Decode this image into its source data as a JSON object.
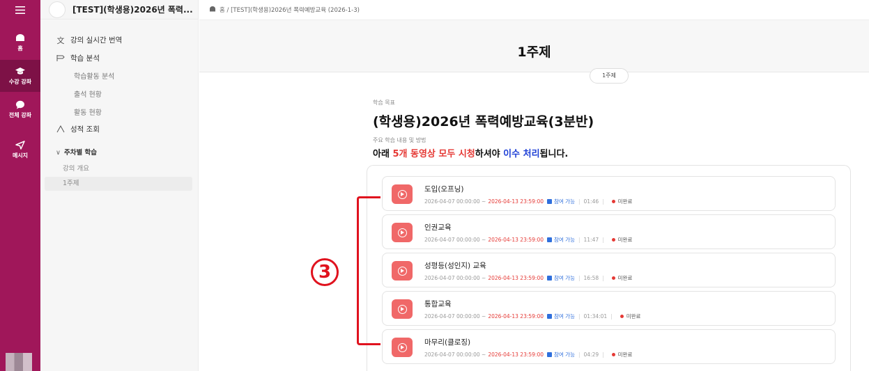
{
  "rail": {
    "items": [
      {
        "label": "홈",
        "icon": "home-icon"
      },
      {
        "label": "수강 강좌",
        "icon": "graduation-cap-icon"
      },
      {
        "label": "전체 강좌",
        "icon": "chat-bubble-icon"
      },
      {
        "label": "메시지",
        "icon": "send-icon"
      }
    ]
  },
  "sidebar": {
    "course_title": "[TEST](학생용)2026년 폭력...",
    "menu": [
      {
        "label": "강의 실시간 번역",
        "icon": "translate-icon"
      },
      {
        "label": "학습 분석",
        "icon": "analytics-icon"
      }
    ],
    "sub_items": [
      "학습활동 분석",
      "출석 현황",
      "활동 현황"
    ],
    "grades": {
      "label": "성적 조회",
      "icon": "grade-icon"
    },
    "week_header": "주차별 학습",
    "week_items": [
      "강의 개요",
      "1주제"
    ]
  },
  "breadcrumb": "홈 / [TEST](학생용)2026년 폭력예방교육 (2026-1-3)",
  "page": {
    "title": "1주제",
    "pill": "1주제",
    "goal_label": "학습 목표",
    "goal_title": "(학생용)2026년 폭력예방교육(3분반)",
    "method_label": "주요 학습 내용 및 방법",
    "notice": {
      "p1": "아래 ",
      "p2": "5개 동영상 모두 시청",
      "p3": "하셔야 ",
      "p4": "이수 처리",
      "p5": "됩니다."
    }
  },
  "activities": [
    {
      "name": "도입(오프닝)",
      "start": "2026-04-07 00:00:00",
      "end": "2026-04-13 23:59:00",
      "availability": "참여 가능",
      "duration": "01:46",
      "status": "미완료"
    },
    {
      "name": "인권교육",
      "start": "2026-04-07 00:00:00",
      "end": "2026-04-13 23:59:00",
      "availability": "참여 가능",
      "duration": "11:47",
      "status": "미완료"
    },
    {
      "name": "성평등(성인지) 교육",
      "start": "2026-04-07 00:00:00",
      "end": "2026-04-13 23:59:00",
      "availability": "참여 가능",
      "duration": "16:58",
      "status": "미완료"
    },
    {
      "name": "통합교육",
      "start": "2026-04-07 00:00:00",
      "end": "2026-04-13 23:59:00",
      "availability": "참여 가능",
      "duration": "01:34:01",
      "status": "미완료"
    },
    {
      "name": "마무리(클로징)",
      "start": "2026-04-07 00:00:00",
      "end": "2026-04-13 23:59:00",
      "availability": "참여 가능",
      "duration": "04:29",
      "status": "미완료"
    }
  ],
  "annotation": {
    "marker": "3"
  },
  "colors": {
    "brand": "#a0175a",
    "accent_red": "#e53935",
    "accent_blue": "#1d3fd6",
    "play": "#f06868"
  }
}
